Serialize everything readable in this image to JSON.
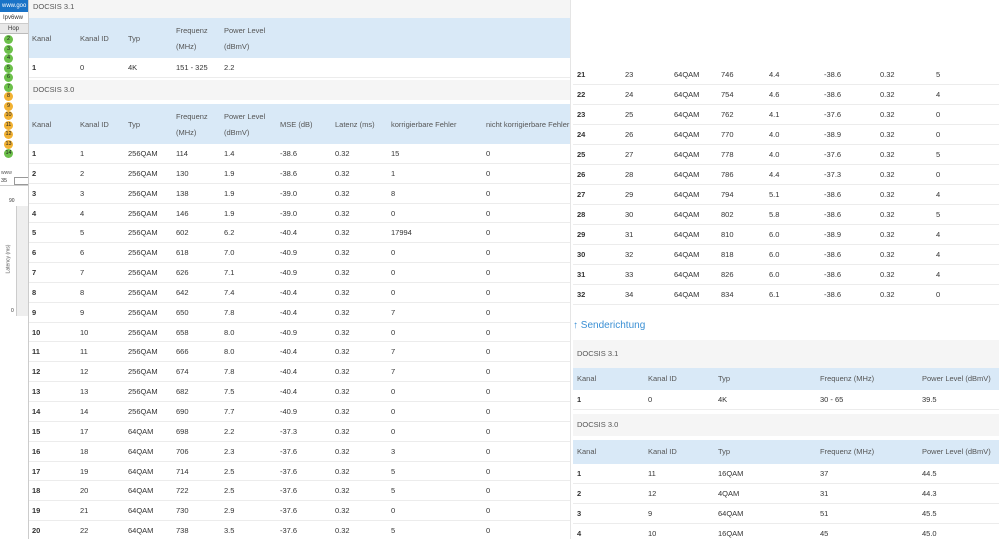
{
  "sidebar": {
    "url": "www.goo",
    "tab": "Ipv6ww",
    "hop_header": "Hop",
    "hops": [
      {
        "n": "2",
        "color": "#6cc04a"
      },
      {
        "n": "3",
        "color": "#6cc04a"
      },
      {
        "n": "4",
        "color": "#6cc04a"
      },
      {
        "n": "5",
        "color": "#6cc04a"
      },
      {
        "n": "6",
        "color": "#6cc04a"
      },
      {
        "n": "7",
        "color": "#6cc04a"
      },
      {
        "n": "8",
        "color": "#f2b233"
      },
      {
        "n": "9",
        "color": "#f2b233"
      },
      {
        "n": "10",
        "color": "#f2b233"
      },
      {
        "n": "11",
        "color": "#f2b233"
      },
      {
        "n": "12",
        "color": "#f2b233"
      },
      {
        "n": "13",
        "color": "#f2b233"
      },
      {
        "n": "14",
        "color": "#6cc04a"
      }
    ],
    "small_url": "www",
    "value_35": "35",
    "y_top": "90",
    "y_axis_label": "Latency (ms)",
    "y_bottom": "0"
  },
  "down31": {
    "title": "DOCSIS 3.1",
    "headers": [
      "Kanal",
      "Kanal ID",
      "Typ",
      "Frequenz",
      "(MHz)",
      "Power Level",
      "(dBmV)"
    ],
    "rows": [
      [
        "1",
        "0",
        "4K",
        "151 - 325",
        "2.2"
      ]
    ]
  },
  "down30": {
    "title": "DOCSIS 3.0",
    "headers": [
      "Kanal",
      "Kanal ID",
      "Typ",
      "Frequenz",
      "(MHz)",
      "Power Level",
      "(dBmV)",
      "MSE (dB)",
      "Latenz (ms)",
      "korrigierbare Fehler",
      "nicht korrigierbare Fehler"
    ],
    "rows": [
      [
        "1",
        "1",
        "256QAM",
        "114",
        "1.4",
        "-38.6",
        "0.32",
        "15",
        "0"
      ],
      [
        "2",
        "2",
        "256QAM",
        "130",
        "1.9",
        "-38.6",
        "0.32",
        "1",
        "0"
      ],
      [
        "3",
        "3",
        "256QAM",
        "138",
        "1.9",
        "-39.0",
        "0.32",
        "8",
        "0"
      ],
      [
        "4",
        "4",
        "256QAM",
        "146",
        "1.9",
        "-39.0",
        "0.32",
        "0",
        "0"
      ],
      [
        "5",
        "5",
        "256QAM",
        "602",
        "6.2",
        "-40.4",
        "0.32",
        "17994",
        "0"
      ],
      [
        "6",
        "6",
        "256QAM",
        "618",
        "7.0",
        "-40.9",
        "0.32",
        "0",
        "0"
      ],
      [
        "7",
        "7",
        "256QAM",
        "626",
        "7.1",
        "-40.9",
        "0.32",
        "0",
        "0"
      ],
      [
        "8",
        "8",
        "256QAM",
        "642",
        "7.4",
        "-40.4",
        "0.32",
        "0",
        "0"
      ],
      [
        "9",
        "9",
        "256QAM",
        "650",
        "7.8",
        "-40.4",
        "0.32",
        "7",
        "0"
      ],
      [
        "10",
        "10",
        "256QAM",
        "658",
        "8.0",
        "-40.9",
        "0.32",
        "0",
        "0"
      ],
      [
        "11",
        "11",
        "256QAM",
        "666",
        "8.0",
        "-40.4",
        "0.32",
        "7",
        "0"
      ],
      [
        "12",
        "12",
        "256QAM",
        "674",
        "7.8",
        "-40.4",
        "0.32",
        "7",
        "0"
      ],
      [
        "13",
        "13",
        "256QAM",
        "682",
        "7.5",
        "-40.4",
        "0.32",
        "0",
        "0"
      ],
      [
        "14",
        "14",
        "256QAM",
        "690",
        "7.7",
        "-40.9",
        "0.32",
        "0",
        "0"
      ],
      [
        "15",
        "17",
        "64QAM",
        "698",
        "2.2",
        "-37.3",
        "0.32",
        "0",
        "0"
      ],
      [
        "16",
        "18",
        "64QAM",
        "706",
        "2.3",
        "-37.6",
        "0.32",
        "3",
        "0"
      ],
      [
        "17",
        "19",
        "64QAM",
        "714",
        "2.5",
        "-37.6",
        "0.32",
        "5",
        "0"
      ],
      [
        "18",
        "20",
        "64QAM",
        "722",
        "2.5",
        "-37.6",
        "0.32",
        "5",
        "0"
      ],
      [
        "19",
        "21",
        "64QAM",
        "730",
        "2.9",
        "-37.6",
        "0.32",
        "0",
        "0"
      ],
      [
        "20",
        "22",
        "64QAM",
        "738",
        "3.5",
        "-37.6",
        "0.32",
        "5",
        "0"
      ]
    ],
    "rows_cont": [
      [
        "21",
        "23",
        "64QAM",
        "746",
        "4.4",
        "-38.6",
        "0.32",
        "5"
      ],
      [
        "22",
        "24",
        "64QAM",
        "754",
        "4.6",
        "-38.6",
        "0.32",
        "4"
      ],
      [
        "23",
        "25",
        "64QAM",
        "762",
        "4.1",
        "-37.6",
        "0.32",
        "0"
      ],
      [
        "24",
        "26",
        "64QAM",
        "770",
        "4.0",
        "-38.9",
        "0.32",
        "0"
      ],
      [
        "25",
        "27",
        "64QAM",
        "778",
        "4.0",
        "-37.6",
        "0.32",
        "5"
      ],
      [
        "26",
        "28",
        "64QAM",
        "786",
        "4.4",
        "-37.3",
        "0.32",
        "0"
      ],
      [
        "27",
        "29",
        "64QAM",
        "794",
        "5.1",
        "-38.6",
        "0.32",
        "4"
      ],
      [
        "28",
        "30",
        "64QAM",
        "802",
        "5.8",
        "-38.6",
        "0.32",
        "5"
      ],
      [
        "29",
        "31",
        "64QAM",
        "810",
        "6.0",
        "-38.9",
        "0.32",
        "4"
      ],
      [
        "30",
        "32",
        "64QAM",
        "818",
        "6.0",
        "-38.6",
        "0.32",
        "4"
      ],
      [
        "31",
        "33",
        "64QAM",
        "826",
        "6.0",
        "-38.6",
        "0.32",
        "4"
      ],
      [
        "32",
        "34",
        "64QAM",
        "834",
        "6.1",
        "-38.6",
        "0.32",
        "0"
      ]
    ]
  },
  "upstream": {
    "link": "↑ Senderichtung",
    "d31": {
      "title": "DOCSIS 3.1",
      "headers": [
        "Kanal",
        "Kanal ID",
        "Typ",
        "Frequenz (MHz)",
        "Power Level (dBmV)"
      ],
      "rows": [
        [
          "1",
          "0",
          "4K",
          "30 - 65",
          "39.5"
        ]
      ]
    },
    "d30": {
      "title": "DOCSIS 3.0",
      "headers": [
        "Kanal",
        "Kanal ID",
        "Typ",
        "Frequenz (MHz)",
        "Power Level (dBmV)"
      ],
      "rows": [
        [
          "1",
          "11",
          "16QAM",
          "37",
          "44.5"
        ],
        [
          "2",
          "12",
          "4QAM",
          "31",
          "44.3"
        ],
        [
          "3",
          "9",
          "64QAM",
          "51",
          "45.5"
        ],
        [
          "4",
          "10",
          "16QAM",
          "45",
          "45.0"
        ]
      ]
    }
  }
}
